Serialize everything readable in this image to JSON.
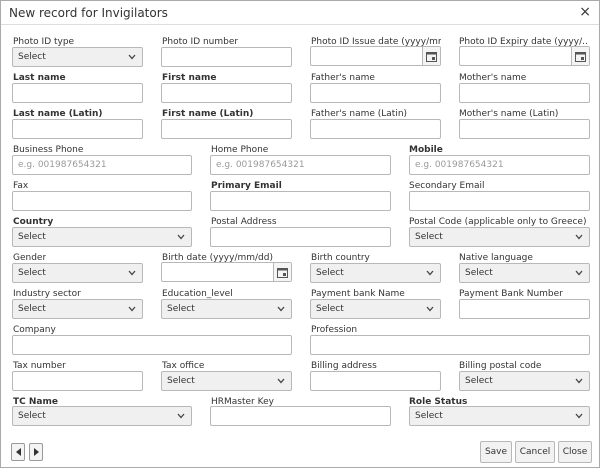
{
  "dialog": {
    "title": "New record for Invigilators",
    "close_glyph": "×"
  },
  "fields": {
    "photo_id_type": {
      "label": "Photo ID type",
      "value": "Select"
    },
    "photo_id_number": {
      "label": "Photo ID number",
      "value": ""
    },
    "photo_id_issue_date": {
      "label": "Photo ID Issue date (yyyy/mm...",
      "value": ""
    },
    "photo_id_expiry_date": {
      "label": "Photo ID Expiry date (yyyy/...",
      "value": ""
    },
    "last_name": {
      "label": "Last name",
      "value": ""
    },
    "first_name": {
      "label": "First name",
      "value": ""
    },
    "fathers_name": {
      "label": "Father's name",
      "value": ""
    },
    "mothers_name": {
      "label": "Mother's name",
      "value": ""
    },
    "last_name_latin": {
      "label": "Last name (Latin)",
      "value": ""
    },
    "first_name_latin": {
      "label": "First name (Latin)",
      "value": ""
    },
    "fathers_name_latin": {
      "label": "Father's name (Latin)",
      "value": ""
    },
    "mothers_name_latin": {
      "label": "Mother's name (Latin)",
      "value": ""
    },
    "business_phone": {
      "label": "Business Phone",
      "placeholder": "e.g. 001987654321"
    },
    "home_phone": {
      "label": "Home Phone",
      "placeholder": "e.g. 001987654321"
    },
    "mobile": {
      "label": "Mobile",
      "placeholder": "e.g. 001987654321"
    },
    "fax": {
      "label": "Fax",
      "value": ""
    },
    "primary_email": {
      "label": "Primary Email",
      "value": ""
    },
    "secondary_email": {
      "label": "Secondary Email",
      "value": ""
    },
    "country": {
      "label": "Country",
      "value": "Select"
    },
    "postal_address": {
      "label": "Postal Address",
      "value": ""
    },
    "postal_code": {
      "label": "Postal Code (applicable only to Greece)",
      "value": "Select"
    },
    "gender": {
      "label": "Gender",
      "value": "Select"
    },
    "birth_date": {
      "label": "Birth date (yyyy/mm/dd)",
      "value": ""
    },
    "birth_country": {
      "label": "Birth country",
      "value": "Select"
    },
    "native_language": {
      "label": "Native language",
      "value": "Select"
    },
    "industry_sector": {
      "label": "Industry sector",
      "value": "Select"
    },
    "education_level": {
      "label": "Education_level",
      "value": "Select"
    },
    "payment_bank_name": {
      "label": "Payment bank Name",
      "value": "Select"
    },
    "payment_bank_number": {
      "label": "Payment Bank Number",
      "value": ""
    },
    "company": {
      "label": "Company",
      "value": ""
    },
    "profession": {
      "label": "Profession",
      "value": ""
    },
    "tax_number": {
      "label": "Tax number",
      "value": ""
    },
    "tax_office": {
      "label": "Tax office",
      "value": "Select"
    },
    "billing_address": {
      "label": "Billing address",
      "value": ""
    },
    "billing_postal_code": {
      "label": "Billing postal code",
      "value": "Select"
    },
    "tc_name": {
      "label": "TC Name",
      "value": "Select"
    },
    "hrmaster_key": {
      "label": "HRMaster Key",
      "value": ""
    },
    "role_status": {
      "label": "Role Status",
      "value": "Select"
    }
  },
  "footer": {
    "save_label": "Save",
    "cancel_label": "Cancel",
    "close_label": "Close"
  }
}
